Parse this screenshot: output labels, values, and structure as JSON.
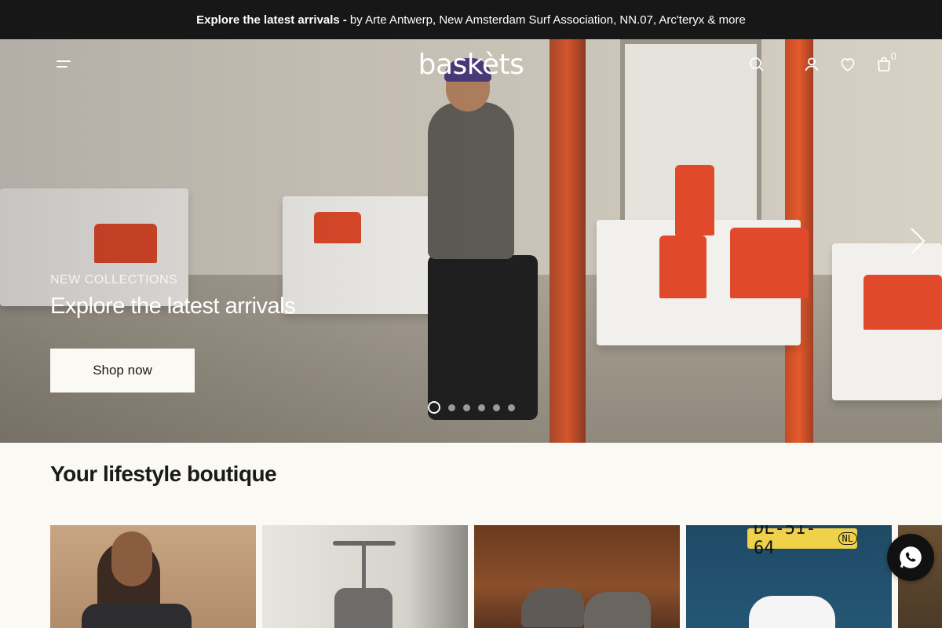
{
  "announcement": {
    "bold": "Explore the latest arrivals -",
    "rest": "by Arte Antwerp, New Amsterdam Surf Association, NN.07, Arc'teryx & more"
  },
  "header": {
    "logo": "baskèts",
    "cart_count": "0",
    "icons": [
      "menu-icon",
      "search-icon",
      "account-icon",
      "wishlist-icon",
      "cart-icon"
    ]
  },
  "hero": {
    "eyebrow": "NEW COLLECTIONS",
    "headline": "Explore the latest arrivals",
    "cta_label": "Shop now",
    "slide_count": 6,
    "active_slide": 1
  },
  "section": {
    "title": "Your lifestyle boutique"
  },
  "cards": [
    {
      "name": "lifestyle-card-1"
    },
    {
      "name": "lifestyle-card-2"
    },
    {
      "name": "lifestyle-card-3"
    },
    {
      "name": "lifestyle-card-4",
      "plate_text": "DL-51-64",
      "plate_country": "NL"
    },
    {
      "name": "lifestyle-card-5"
    }
  ],
  "colors": {
    "announcement_bg": "#171717",
    "page_bg": "#fbf9f4",
    "chat_button": "#111111"
  }
}
